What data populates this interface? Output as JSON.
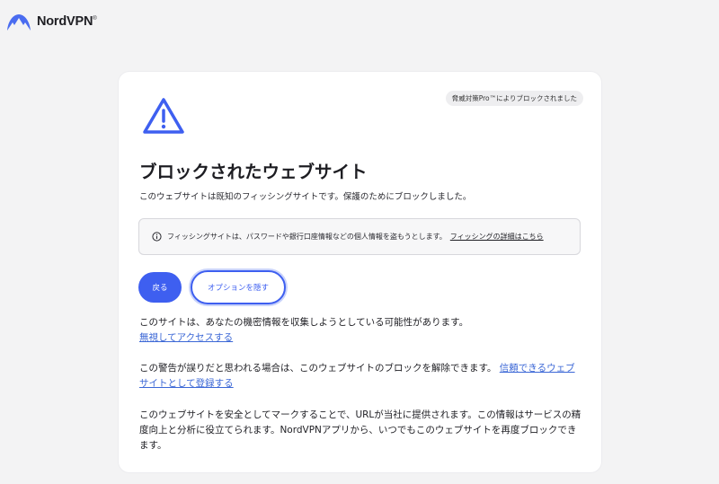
{
  "brand": {
    "name": "NordVPN",
    "trademark": "®"
  },
  "badge": "脅威対策Pro™によりブロックされました",
  "title": "ブロックされたウェブサイト",
  "subtitle": "このウェブサイトは既知のフィッシングサイトです。保護のためにブロックしました。",
  "info": {
    "text": "フィッシングサイトは、パスワードや銀行口座情報などの個人情報を盗もうとします。",
    "link": "フィッシングの詳細はこちら"
  },
  "buttons": {
    "back": "戻る",
    "options": "オプションを隠す"
  },
  "options": {
    "p1_text": "このサイトは、あなたの機密情報を収集しようとしている可能性があります。",
    "p1_link": "無視してアクセスする",
    "p2_text": "この警告が誤りだと思われる場合は、このウェブサイトのブロックを解除できます。",
    "p2_link": "信頼できるウェブサイトとして登録する",
    "p3_text": "このウェブサイトを安全としてマークすることで、URLが当社に提供されます。この情報はサービスの精度向上と分析に役立てられます。NordVPNアプリから、いつでもこのウェブサイトを再度ブロックできます。"
  },
  "colors": {
    "accent": "#3e5ff0",
    "link": "#3b67d6",
    "background": "#f3f3f4"
  },
  "icons": {
    "logo": "nordvpn-mountain-logo",
    "warning": "warning-triangle-icon",
    "info": "info-circle-icon"
  }
}
